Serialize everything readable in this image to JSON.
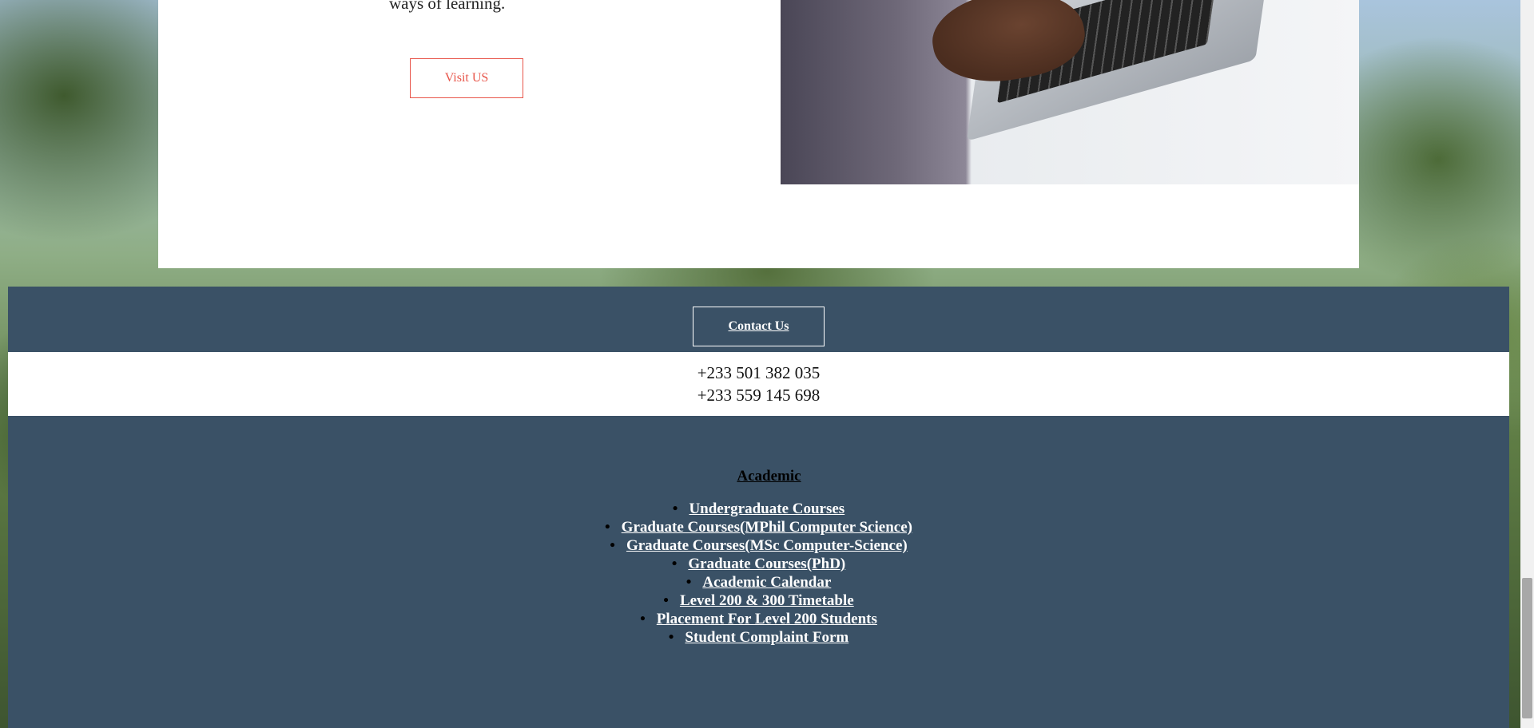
{
  "hero": {
    "text_fragment": "ways of learning.",
    "visit_button_label": "Visit US"
  },
  "contact": {
    "button_label": "Contact Us",
    "phones": [
      "+233 501 382 035",
      "+233 559 145 698"
    ]
  },
  "academic": {
    "title": "Academic",
    "links": [
      "Undergraduate Courses",
      "Graduate Courses(MPhil Computer Science)",
      "Graduate Courses(MSc Computer-Science)",
      "Graduate Courses(PhD)",
      "Academic Calendar",
      "Level 200 & 300 Timetable",
      "Placement For Level 200 Students",
      "Student Complaint Form"
    ]
  },
  "colors": {
    "footer_bg": "#3a5166",
    "accent": "#e8554a"
  }
}
